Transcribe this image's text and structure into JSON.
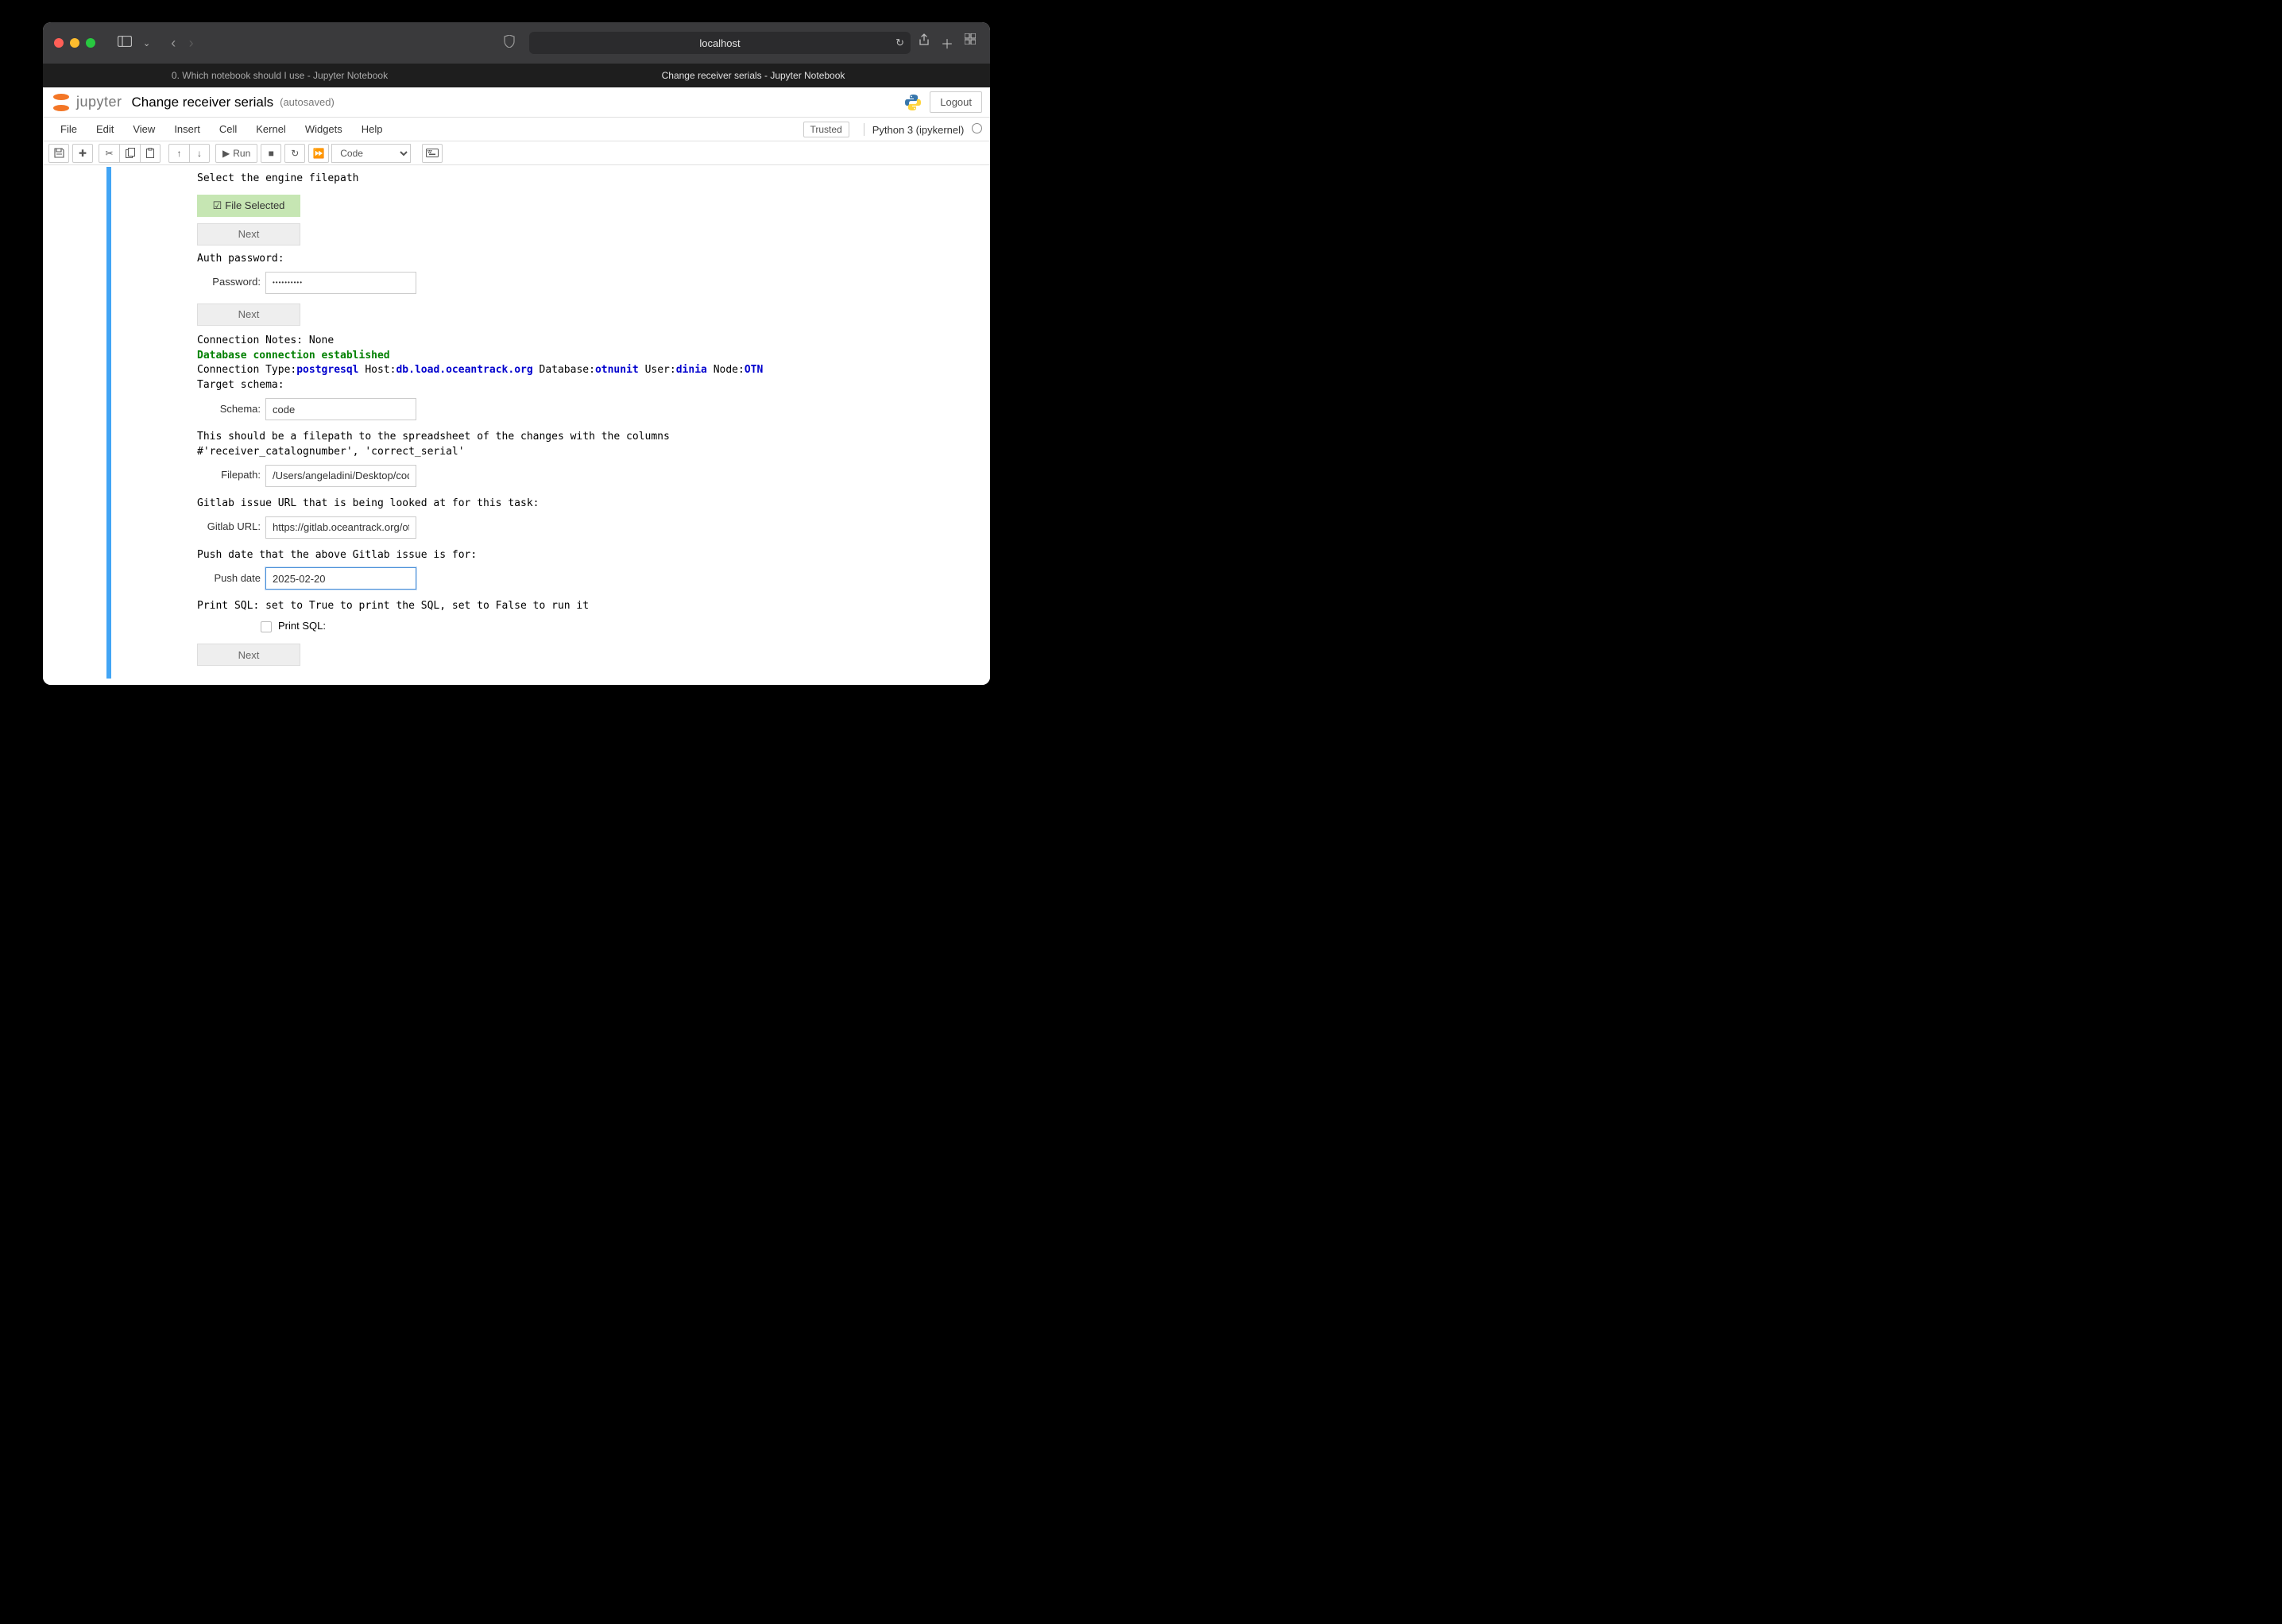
{
  "browser": {
    "url": "localhost",
    "tabs": [
      "0. Which notebook should I use - Jupyter Notebook",
      "Change receiver serials - Jupyter Notebook"
    ]
  },
  "header": {
    "logo_text": "jupyter",
    "title": "Change receiver serials",
    "autosave": "(autosaved)",
    "logout": "Logout"
  },
  "menubar": {
    "items": [
      "File",
      "Edit",
      "View",
      "Insert",
      "Cell",
      "Kernel",
      "Widgets",
      "Help"
    ],
    "trusted": "Trusted",
    "kernel": "Python 3 (ipykernel)"
  },
  "toolbar": {
    "run": "Run",
    "celltype": "Code"
  },
  "output": {
    "engine_label": "Select the engine filepath",
    "file_selected": "File Selected",
    "next": "Next",
    "auth_label": "Auth password:",
    "password_label": "Password:",
    "conn_notes": "Connection Notes: None",
    "conn_established": "Database connection established",
    "conn_type_label": "Connection Type:",
    "conn_type": "postgresql",
    "host_label": "Host:",
    "host": "db.load.oceantrack.org",
    "db_label": "Database:",
    "db": "otnunit",
    "user_label": "User:",
    "user": "dinia",
    "node_label": "Node:",
    "node": "OTN",
    "target_schema_label": "Target schema:",
    "schema_label": "Schema:",
    "schema_value": "code",
    "filepath_desc1": "This should be a filepath to the spreadsheet of the changes with the columns",
    "filepath_desc2": "#'receiver_catalognumber', 'correct_serial'",
    "filepath_label": "Filepath:",
    "filepath_value": "/Users/angeladini/Desktop/code_",
    "gitlab_desc": "Gitlab issue URL that is being looked at for this task:",
    "gitlab_label": "Gitlab URL:",
    "gitlab_value": "https://gitlab.oceantrack.org/otn-",
    "pushdate_desc": "Push date that the above Gitlab issue is for:",
    "pushdate_label": "Push date",
    "pushdate_value": "2025-02-20",
    "printsql_desc": "Print SQL: set to True to print the SQL, set to False to run it",
    "printsql_label": "Print SQL:"
  }
}
